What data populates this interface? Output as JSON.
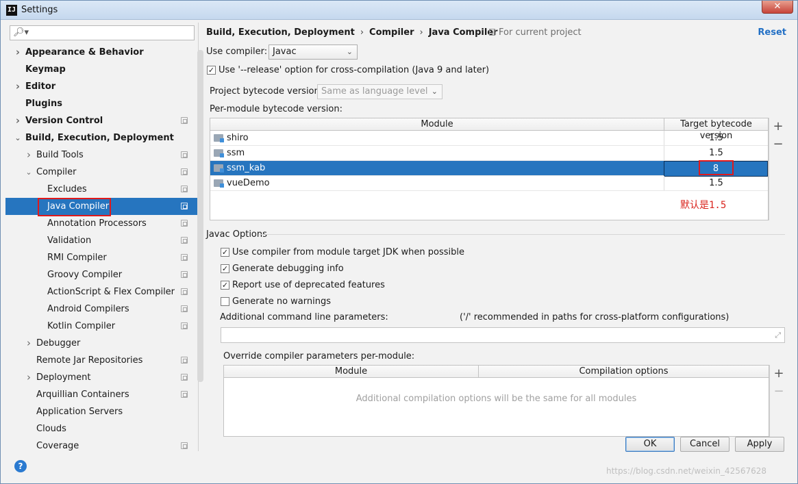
{
  "window": {
    "title": "Settings",
    "app_icon": "IJ",
    "close_glyph": "✕"
  },
  "search": {
    "placeholder": ""
  },
  "tree": [
    {
      "label": "Appearance & Behavior",
      "indent": 0,
      "bold": true,
      "arrow": "right",
      "copy": false
    },
    {
      "label": "Keymap",
      "indent": 0,
      "bold": true,
      "arrow": "",
      "copy": false
    },
    {
      "label": "Editor",
      "indent": 0,
      "bold": true,
      "arrow": "right",
      "copy": false
    },
    {
      "label": "Plugins",
      "indent": 0,
      "bold": true,
      "arrow": "",
      "copy": false
    },
    {
      "label": "Version Control",
      "indent": 0,
      "bold": true,
      "arrow": "right",
      "copy": true
    },
    {
      "label": "Build, Execution, Deployment",
      "indent": 0,
      "bold": true,
      "arrow": "down",
      "copy": false
    },
    {
      "label": "Build Tools",
      "indent": 1,
      "bold": false,
      "arrow": "right",
      "copy": true
    },
    {
      "label": "Compiler",
      "indent": 1,
      "bold": false,
      "arrow": "down",
      "copy": true
    },
    {
      "label": "Excludes",
      "indent": 2,
      "bold": false,
      "arrow": "",
      "copy": true
    },
    {
      "label": "Java Compiler",
      "indent": 2,
      "bold": false,
      "arrow": "",
      "copy": true,
      "selected": true,
      "highlight": true
    },
    {
      "label": "Annotation Processors",
      "indent": 2,
      "bold": false,
      "arrow": "",
      "copy": true
    },
    {
      "label": "Validation",
      "indent": 2,
      "bold": false,
      "arrow": "",
      "copy": true
    },
    {
      "label": "RMI Compiler",
      "indent": 2,
      "bold": false,
      "arrow": "",
      "copy": true
    },
    {
      "label": "Groovy Compiler",
      "indent": 2,
      "bold": false,
      "arrow": "",
      "copy": true
    },
    {
      "label": "ActionScript & Flex Compiler",
      "indent": 2,
      "bold": false,
      "arrow": "",
      "copy": true
    },
    {
      "label": "Android Compilers",
      "indent": 2,
      "bold": false,
      "arrow": "",
      "copy": true
    },
    {
      "label": "Kotlin Compiler",
      "indent": 2,
      "bold": false,
      "arrow": "",
      "copy": true
    },
    {
      "label": "Debugger",
      "indent": 1,
      "bold": false,
      "arrow": "right",
      "copy": false
    },
    {
      "label": "Remote Jar Repositories",
      "indent": 1,
      "bold": false,
      "arrow": "",
      "copy": true
    },
    {
      "label": "Deployment",
      "indent": 1,
      "bold": false,
      "arrow": "right",
      "copy": true
    },
    {
      "label": "Arquillian Containers",
      "indent": 1,
      "bold": false,
      "arrow": "",
      "copy": true
    },
    {
      "label": "Application Servers",
      "indent": 1,
      "bold": false,
      "arrow": "",
      "copy": false
    },
    {
      "label": "Clouds",
      "indent": 1,
      "bold": false,
      "arrow": "",
      "copy": false
    },
    {
      "label": "Coverage",
      "indent": 1,
      "bold": false,
      "arrow": "",
      "copy": true
    }
  ],
  "breadcrumb": {
    "part1": "Build, Execution, Deployment",
    "part2": "Compiler",
    "part3": "Java Compiler",
    "separator": "›"
  },
  "header": {
    "for_project": "For current project",
    "reset": "Reset"
  },
  "compiler": {
    "use_label": "Use compiler:",
    "use_value": "Javac"
  },
  "release_option": {
    "label": "Use '--release' option for cross-compilation (Java 9 and later)",
    "checked": true
  },
  "bytecode": {
    "project_label": "Project bytecode version:",
    "project_value": "Same as language level",
    "per_module_label": "Per-module bytecode version:"
  },
  "modules_table": {
    "headers": [
      "Module",
      "Target bytecode version"
    ],
    "rows": [
      {
        "module": "shiro",
        "version": "1.5",
        "selected": false
      },
      {
        "module": "ssm",
        "version": "1.5",
        "selected": false
      },
      {
        "module": "ssm_kab",
        "version": "8",
        "selected": true
      },
      {
        "module": "vueDemo",
        "version": "1.5",
        "selected": false
      }
    ],
    "add": "+",
    "remove": "−"
  },
  "annotation_note": "默认是1.5",
  "javac_options": {
    "section_title": "Javac Options",
    "checks": [
      {
        "label": "Use compiler from module target JDK when possible",
        "checked": true
      },
      {
        "label": "Generate debugging info",
        "checked": true
      },
      {
        "label": "Report use of deprecated features",
        "checked": true
      },
      {
        "label": "Generate no warnings",
        "checked": false
      }
    ],
    "cmd_label": "Additional command line parameters:",
    "cmd_hint": "('/' recommended in paths for cross-platform configurations)",
    "cmd_value": "",
    "override_label": "Override compiler parameters per-module:",
    "override_headers": [
      "Module",
      "Compilation options"
    ],
    "override_empty": "Additional compilation options will be the same for all modules"
  },
  "buttons": {
    "ok": "OK",
    "cancel": "Cancel",
    "apply": "Apply",
    "help": "?"
  },
  "watermark": "https://blog.csdn.net/weixin_42567628",
  "colors": {
    "selection": "#2675bf",
    "link": "#2370c5",
    "annotation_red": "#e0191b"
  }
}
